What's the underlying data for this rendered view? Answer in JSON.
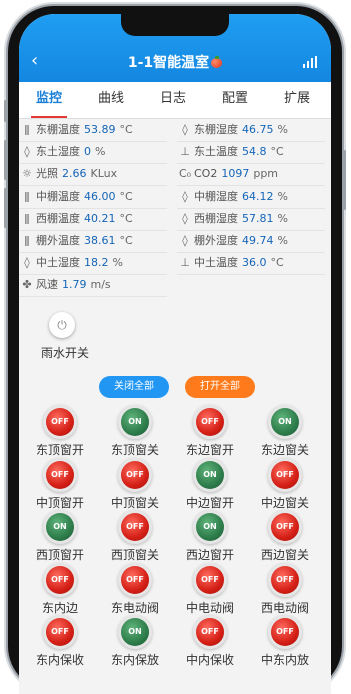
{
  "header": {
    "back_icon": "chevron-left-icon",
    "title": "1-1智能温室",
    "signal_icon": "signal-icon"
  },
  "tabs": [
    {
      "label": "监控",
      "active": true
    },
    {
      "label": "曲线"
    },
    {
      "label": "日志"
    },
    {
      "label": "配置"
    },
    {
      "label": "扩展"
    }
  ],
  "sensors_left": [
    {
      "icon": "thermometer-icon",
      "name": "东棚温度",
      "value": "53.89",
      "unit": "°C"
    },
    {
      "icon": "water-drop-icon",
      "name": "东土湿度",
      "value": "0",
      "unit": "%"
    },
    {
      "icon": "sun-icon",
      "name": "光照",
      "value": "2.66",
      "unit": "KLux"
    },
    {
      "icon": "thermometer-icon",
      "name": "中棚温度",
      "value": "46.00",
      "unit": "°C"
    },
    {
      "icon": "thermometer-icon",
      "name": "西棚温度",
      "value": "40.21",
      "unit": "°C"
    },
    {
      "icon": "thermometer-icon",
      "name": "棚外温度",
      "value": "38.61",
      "unit": "°C"
    },
    {
      "icon": "water-drop-icon",
      "name": "中土湿度",
      "value": "18.2",
      "unit": "%"
    },
    {
      "icon": "fan-icon",
      "name": "风速",
      "value": "1.79",
      "unit": "m/s"
    }
  ],
  "sensors_right": [
    {
      "icon": "humidity-icon",
      "name": "东棚湿度",
      "value": "46.75",
      "unit": "%"
    },
    {
      "icon": "soil-temp-icon",
      "name": "东土温度",
      "value": "54.8",
      "unit": "°C"
    },
    {
      "icon": "co2-icon",
      "name": "CO2",
      "value": "1097",
      "unit": "ppm"
    },
    {
      "icon": "humidity-icon",
      "name": "中棚湿度",
      "value": "64.12",
      "unit": "%"
    },
    {
      "icon": "humidity-icon",
      "name": "西棚湿度",
      "value": "57.81",
      "unit": "%"
    },
    {
      "icon": "humidity-icon",
      "name": "棚外湿度",
      "value": "49.74",
      "unit": "%"
    },
    {
      "icon": "soil-temp-icon",
      "name": "中土温度",
      "value": "36.0",
      "unit": "°C"
    }
  ],
  "rain_switch": {
    "icon": "power-icon",
    "label": "雨水开关"
  },
  "bulk": {
    "close_all": "关闭全部",
    "open_all": "打开全部",
    "close_color": "#2196f3",
    "open_color": "#ff7a1a"
  },
  "switches": [
    {
      "label": "东顶窗开",
      "state": "OFF"
    },
    {
      "label": "东顶窗关",
      "state": "ON"
    },
    {
      "label": "东边窗开",
      "state": "OFF"
    },
    {
      "label": "东边窗关",
      "state": "ON"
    },
    {
      "label": "中顶窗开",
      "state": "OFF"
    },
    {
      "label": "中顶窗关",
      "state": "OFF"
    },
    {
      "label": "中边窗开",
      "state": "ON"
    },
    {
      "label": "中边窗关",
      "state": "OFF"
    },
    {
      "label": "西顶窗开",
      "state": "ON"
    },
    {
      "label": "西顶窗关",
      "state": "OFF"
    },
    {
      "label": "西边窗开",
      "state": "ON"
    },
    {
      "label": "西边窗关",
      "state": "OFF"
    },
    {
      "label": "东内边",
      "state": "OFF"
    },
    {
      "label": "东电动阀",
      "state": "OFF"
    },
    {
      "label": "中电动阀",
      "state": "OFF"
    },
    {
      "label": "西电动阀",
      "state": "OFF"
    },
    {
      "label": "东内保收",
      "state": "OFF"
    },
    {
      "label": "东内保放",
      "state": "ON"
    },
    {
      "label": "中内保收",
      "state": "OFF"
    },
    {
      "label": "中东内放",
      "state": "OFF"
    }
  ]
}
